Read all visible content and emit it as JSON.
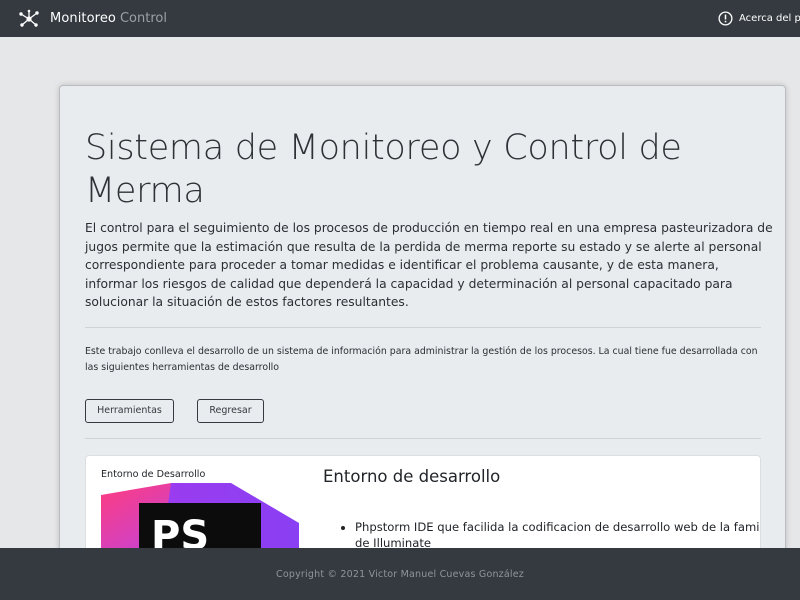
{
  "navbar": {
    "brand_name": "Monitoreo",
    "brand_sub": "Control",
    "brand_icon": "network-nodes-icon",
    "about_label": "Acerca del p",
    "about_icon": "info-circle-icon"
  },
  "main": {
    "title": "Sistema de Monitoreo y Control de Merma",
    "lead": "El control para el seguimiento de los procesos de producción en tiempo real en una empresa pasteurizadora de jugos permite que la estimación que resulta de la perdida de merma reporte su estado y se alerte al personal correspondiente para proceder a tomar medidas e identificar el problema causante, y de esta manera, informar los riesgos de calidad que dependerá la capacidad y determinación al personal capacitado para solucionar la situación de estos factores resultantes.",
    "description": "Este trabajo conlleva el desarrollo de un sistema de información para administrar la gestión de los procesos. La cual tiene fue desarrollada con las siguientes herramientas de desarrollo",
    "buttons": {
      "tools": "Herramientas",
      "back": "Regresar"
    }
  },
  "card": {
    "caption": "Entorno de Desarrollo",
    "image_icon": "phpstorm-logo",
    "image_text": "PS",
    "heading": "Entorno de desarrollo",
    "items": [
      "Phpstorm IDE que facilida la codificacion de desarrollo web de la familia de Illuminate"
    ]
  },
  "footer": {
    "copyright": "Copyright © 2021 Victor Manuel Cuevas González"
  },
  "colors": {
    "navbar_bg": "#343a40",
    "page_bg": "#e6e7e8",
    "jumbotron_bg": "#e9ecef",
    "brand_sub": "#9aa0a6"
  }
}
